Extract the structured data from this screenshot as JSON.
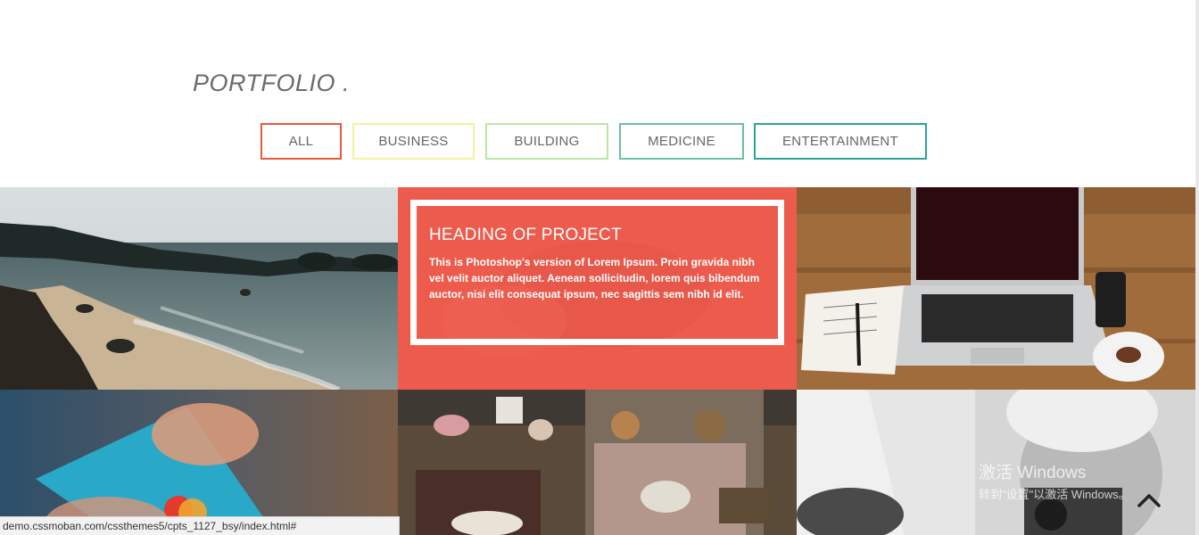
{
  "section": {
    "title": "PORTFOLIO ."
  },
  "filters": [
    {
      "label": "ALL",
      "color": "#e55b3c"
    },
    {
      "label": "BUSINESS",
      "color": "#f3f3a0"
    },
    {
      "label": "BUILDING",
      "color": "#b8e6a3"
    },
    {
      "label": "MEDICINE",
      "color": "#6cc09a"
    },
    {
      "label": "ENTERTAINMENT",
      "color": "#2ba592"
    }
  ],
  "portfolio": {
    "overlay": {
      "heading": "HEADING OF PROJECT",
      "text": "This is Photoshop's version of Lorem Ipsum. Proin gravida nibh vel velit auctor aliquet. Aenean sollicitudin, lorem quis bibendum auctor, nisi elit consequat ipsum, nec sagittis sem nibh id elit.",
      "color": "#ec5b4c"
    }
  },
  "status_bar": {
    "url": "demo.cssmoban.com/cssthemes5/cpts_1127_bsy/index.html#"
  },
  "watermark": {
    "line1": "激活 Windows",
    "line2": "转到\"设置\"以激活 Windows。"
  },
  "icons": {
    "back_to_top": "chevron-up-icon"
  }
}
